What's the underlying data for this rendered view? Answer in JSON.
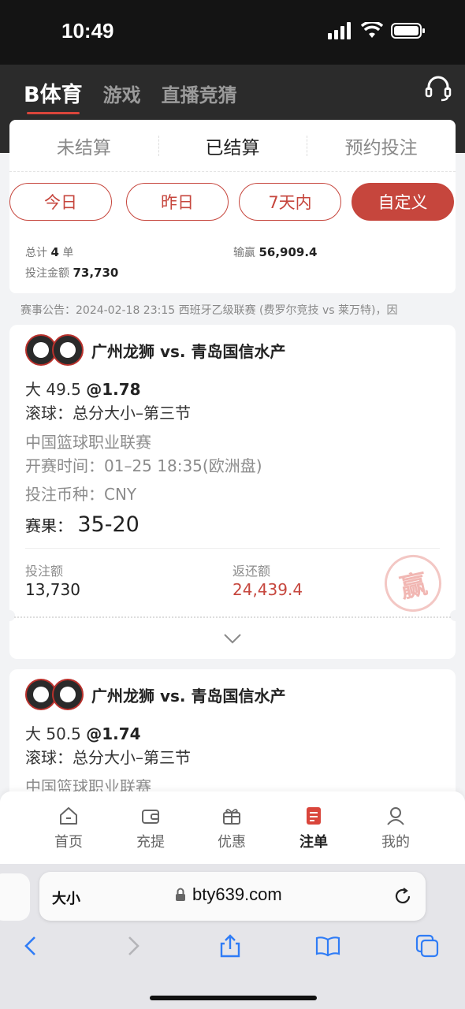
{
  "status_bar": {
    "time": "10:49"
  },
  "header": {
    "tabs": [
      {
        "label": "B体育"
      },
      {
        "label": "游戏"
      },
      {
        "label": "直播竞猜"
      }
    ]
  },
  "settle_tabs": [
    {
      "label": "未结算"
    },
    {
      "label": "已结算"
    },
    {
      "label": "预约投注"
    }
  ],
  "date_filters": [
    {
      "label": "今日"
    },
    {
      "label": "昨日"
    },
    {
      "label": "7天内"
    },
    {
      "label": "自定义"
    }
  ],
  "stats": {
    "total_label": "总计",
    "total_count": "4",
    "total_unit": "单",
    "winloss_label": "输赢",
    "winloss_value": "56,909.4",
    "bet_amount_label": "投注金额",
    "bet_amount_value": "73,730"
  },
  "notice": "赛事公告：2024-02-18 23:15 西班牙乙级联赛 (费罗尔竞技 vs 莱万特)，因",
  "bets": [
    {
      "match": "广州龙狮 vs. 青岛国信水产",
      "selection": "大 49.5",
      "odds": "@1.78",
      "market": "滚球：总分大小–第三节",
      "league": "中国篮球职业联赛",
      "start_time": "开赛时间：01–25 18:35(欧洲盘)",
      "currency": "投注币种：CNY",
      "result_label": "赛果：",
      "result_score": "35-20",
      "stake_label": "投注额",
      "stake_value": "13,730",
      "return_label": "返还额",
      "return_value": "24,439.4",
      "stamp": "赢"
    },
    {
      "match": "广州龙狮 vs. 青岛国信水产",
      "selection": "大 50.5",
      "odds": "@1.74",
      "market": "滚球：总分大小–第三节",
      "league": "中国篮球职业联赛"
    }
  ],
  "bottom_nav": [
    {
      "label": "首页",
      "icon": "home-icon"
    },
    {
      "label": "充提",
      "icon": "wallet-icon"
    },
    {
      "label": "优惠",
      "icon": "gift-icon"
    },
    {
      "label": "注单",
      "icon": "bet-slip-icon"
    },
    {
      "label": "我的",
      "icon": "profile-icon"
    }
  ],
  "browser": {
    "aa_label": "大小",
    "url": "bty639.com"
  },
  "colors": {
    "accent": "#c6463d",
    "header_bg": "#2b2b2b"
  }
}
